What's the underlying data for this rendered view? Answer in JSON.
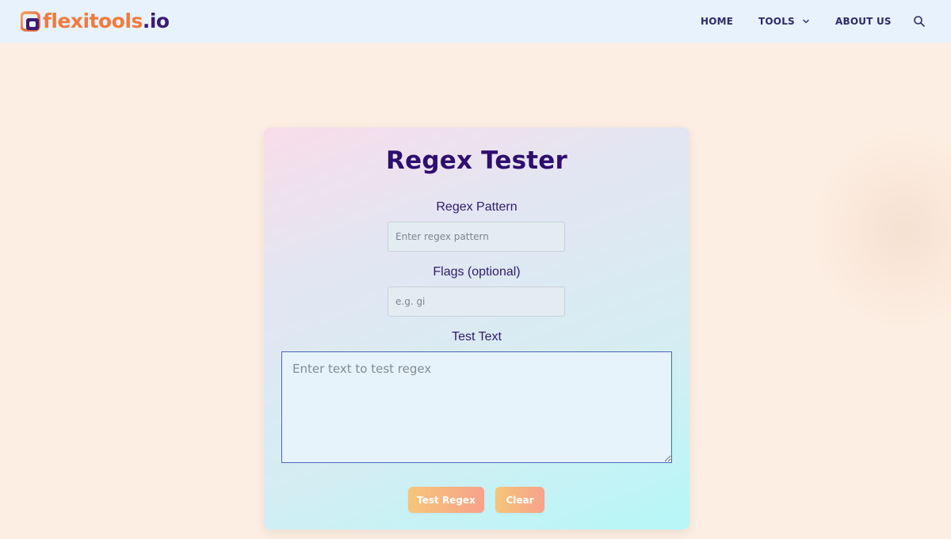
{
  "header": {
    "logo": {
      "brand": "flexitools",
      "tld": ".io"
    },
    "nav": {
      "home": "HOME",
      "tools": "TOOLS",
      "about": "ABOUT US"
    }
  },
  "tool": {
    "title": "Regex Tester",
    "pattern": {
      "label": "Regex Pattern",
      "placeholder": "Enter regex pattern",
      "value": ""
    },
    "flags": {
      "label": "Flags (optional)",
      "placeholder": "e.g. gi",
      "value": ""
    },
    "test_text": {
      "label": "Test Text",
      "placeholder": "Enter text to test regex",
      "value": ""
    },
    "buttons": {
      "test": "Test Regex",
      "clear": "Clear"
    }
  },
  "colors": {
    "brand_orange": "#f07b3f",
    "brand_purple": "#3d1b73",
    "header_bg": "#e8f2fc",
    "page_bg": "#fdeee3",
    "button_gradient_start": "#f7c579",
    "button_gradient_end": "#f7a28a"
  }
}
